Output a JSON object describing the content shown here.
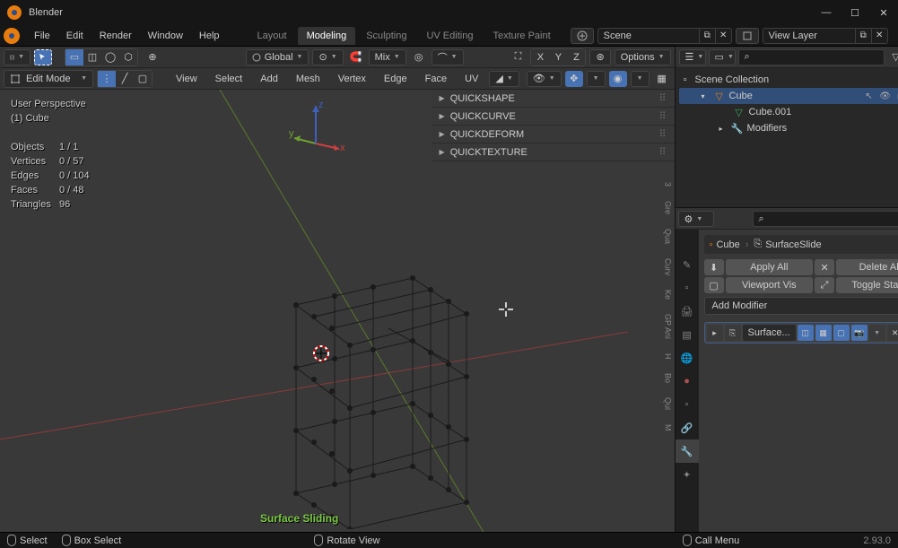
{
  "title_bar": {
    "title": "Blender"
  },
  "window_controls": {
    "min": "—",
    "max": "☐",
    "close": "✕"
  },
  "topbar": {
    "menus": [
      "File",
      "Edit",
      "Render",
      "Window",
      "Help"
    ],
    "workspaces": [
      "Layout",
      "Modeling",
      "Sculpting",
      "UV Editing",
      "Texture Paint"
    ],
    "workspace_active": 1,
    "scene": "Scene",
    "view_layer": "View Layer"
  },
  "vp_header": {
    "orientation": "Global",
    "snap_mode": "Mix",
    "options": "Options",
    "axes": [
      "X",
      "Y",
      "Z"
    ]
  },
  "vp_header2": {
    "mode": "Edit Mode",
    "menus": [
      "View",
      "Select",
      "Add",
      "Mesh",
      "Vertex",
      "Edge",
      "Face",
      "UV"
    ]
  },
  "overlay": {
    "perspective": "User Perspective",
    "object": "(1) Cube",
    "stats": [
      {
        "k": "Objects",
        "v": "1 / 1"
      },
      {
        "k": "Vertices",
        "v": "0 / 57"
      },
      {
        "k": "Edges",
        "v": "0 / 104"
      },
      {
        "k": "Faces",
        "v": "0 / 48"
      },
      {
        "k": "Triangles",
        "v": "96"
      }
    ],
    "surface_sliding": "Surface Sliding"
  },
  "n_panel": {
    "items": [
      "QUICKSHAPE",
      "QUICKCURVE",
      "QUICKDEFORM",
      "QUICKTEXTURE"
    ],
    "tabs": [
      "3",
      "Gre",
      "Qua",
      "Curv",
      "Ke",
      "GP Ani",
      "H",
      "Bo",
      "Qui",
      "M"
    ]
  },
  "axis": {
    "x": "x",
    "y": "y",
    "z": "z"
  },
  "outliner": {
    "collection": "Scene Collection",
    "items": [
      {
        "name": "Cube",
        "icon": "mesh",
        "depth": 1,
        "active": true,
        "toggles": true
      },
      {
        "name": "Cube.001",
        "icon": "mesh-data",
        "depth": 2,
        "active": false
      },
      {
        "name": "Modifiers",
        "icon": "wrench",
        "depth": 2,
        "active": false,
        "extra": true
      }
    ]
  },
  "properties": {
    "breadcrumb": {
      "obj": "Cube",
      "mod": "SurfaceSlide"
    },
    "buttons": {
      "apply_all": "Apply All",
      "delete_all": "Delete All",
      "viewport_vis": "Viewport Vis",
      "toggle_stack": "Toggle Stack"
    },
    "add_modifier": "Add Modifier",
    "mod_name": "Surface..."
  },
  "status": {
    "select": "Select",
    "box_select": "Box Select",
    "rotate_view": "Rotate View",
    "call_menu": "Call Menu",
    "version": "2.93.0"
  },
  "search_icon": "⌕"
}
